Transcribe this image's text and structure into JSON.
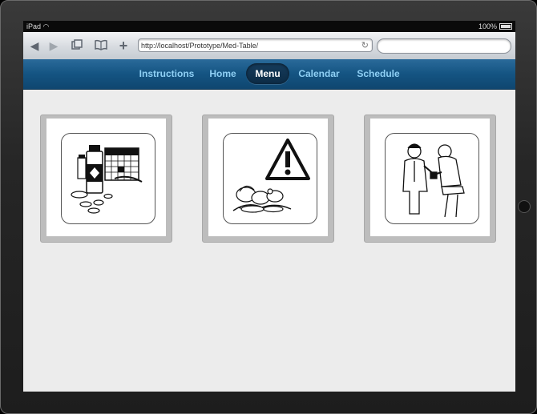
{
  "status_bar": {
    "device": "iPad",
    "battery": "100%"
  },
  "browser": {
    "url": "http://localhost/Prototype/Med-Table/",
    "back_icon": "back-arrow-icon",
    "forward_icon": "forward-arrow-icon",
    "tabs_icon": "tabs-icon",
    "bookmarks_icon": "bookmarks-icon",
    "add_icon": "plus-icon",
    "reload_icon": "reload-icon"
  },
  "nav": {
    "items": [
      {
        "label": "Instructions",
        "active": false
      },
      {
        "label": "Home",
        "active": false
      },
      {
        "label": "Menu",
        "active": true
      },
      {
        "label": "Calendar",
        "active": false
      },
      {
        "label": "Schedule",
        "active": false
      }
    ]
  },
  "cards": [
    {
      "icon": "medication-calendar-icon"
    },
    {
      "icon": "food-warning-icon"
    },
    {
      "icon": "doctor-patient-icon"
    }
  ],
  "colors": {
    "nav_text": "#8fd0f5",
    "nav_bg": "#145482",
    "active_pill": "#0c2b45"
  }
}
